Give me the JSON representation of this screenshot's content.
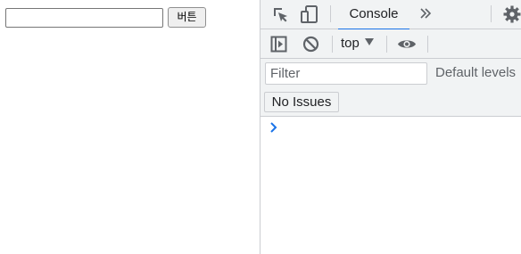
{
  "page": {
    "text_input_value": "",
    "button_label": "버튼"
  },
  "devtools": {
    "tabs": {
      "console_label": "Console"
    },
    "toolbar": {
      "context_label": "top"
    },
    "filter": {
      "placeholder": "Filter",
      "levels_label": "Default levels"
    },
    "issues": {
      "label": "No Issues"
    },
    "colors": {
      "accent": "#1a73e8",
      "panel_bg": "#f1f3f4",
      "border": "#cbcdd1",
      "icon": "#5f6368"
    },
    "icons": [
      "inspect-element-icon",
      "device-toolbar-icon",
      "more-tabs-icon",
      "settings-gear-icon",
      "show-sidebar-icon",
      "clear-console-icon",
      "context-dropdown-icon",
      "live-expression-eye-icon",
      "console-prompt-icon"
    ]
  }
}
